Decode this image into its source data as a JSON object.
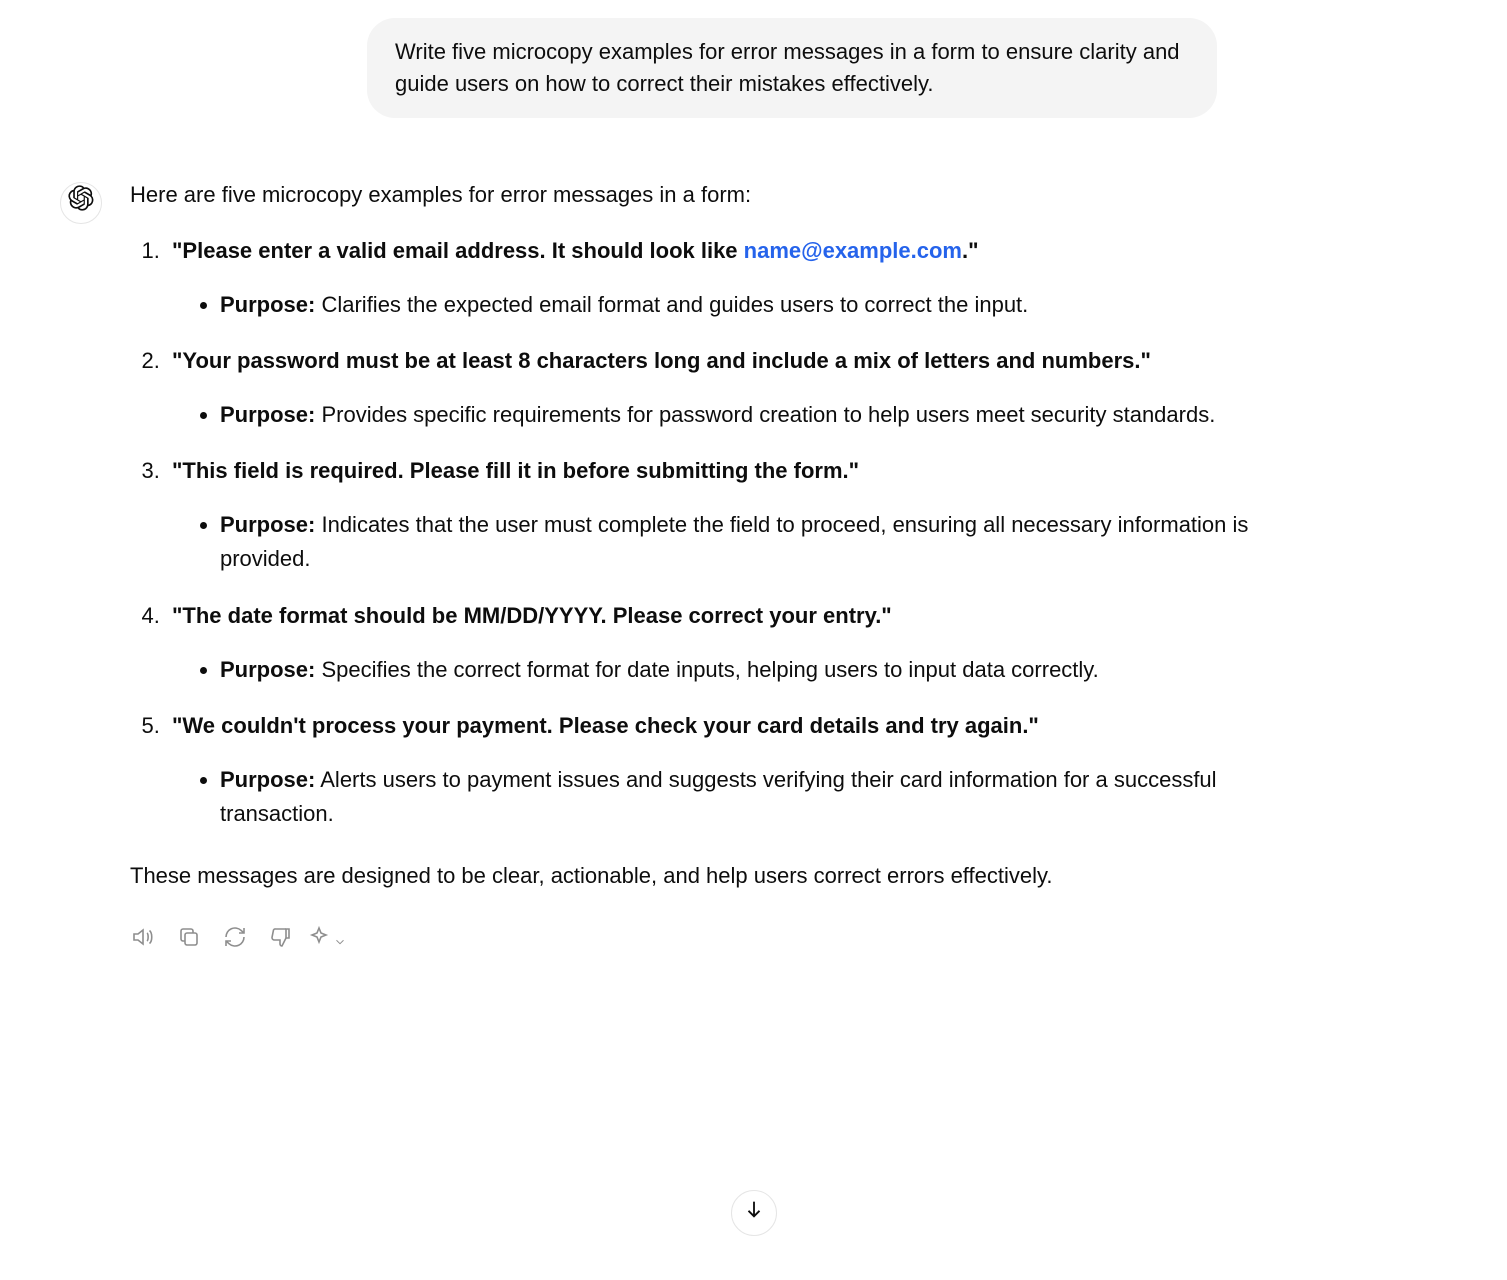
{
  "user": {
    "message": "Write five microcopy examples for error messages in a form to ensure clarity and guide users on how to correct their mistakes effectively."
  },
  "assistant": {
    "intro": "Here are five microcopy examples for error messages in a form:",
    "examples": [
      {
        "prefix": "\"Please enter a valid email address. It should look like ",
        "link": "name@example.com",
        "suffix": ".\"",
        "purpose_label": "Purpose:",
        "purpose": " Clarifies the expected email format and guides users to correct the input."
      },
      {
        "title": "\"Your password must be at least 8 characters long and include a mix of letters and numbers.\"",
        "purpose_label": "Purpose:",
        "purpose": " Provides specific requirements for password creation to help users meet security standards."
      },
      {
        "title": "\"This field is required. Please fill it in before submitting the form.\"",
        "purpose_label": "Purpose:",
        "purpose": " Indicates that the user must complete the field to proceed, ensuring all necessary information is provided."
      },
      {
        "title": "\"The date format should be MM/DD/YYYY. Please correct your entry.\"",
        "purpose_label": "Purpose:",
        "purpose": " Specifies the correct format for date inputs, helping users to input data correctly."
      },
      {
        "title": "\"We couldn't process your payment. Please check your card details and try again.\"",
        "purpose_label": "Purpose:",
        "purpose": " Alerts users to payment issues and suggests verifying their card information for a successful transaction."
      }
    ],
    "closing": "These messages are designed to be clear, actionable, and help users correct errors effectively."
  }
}
